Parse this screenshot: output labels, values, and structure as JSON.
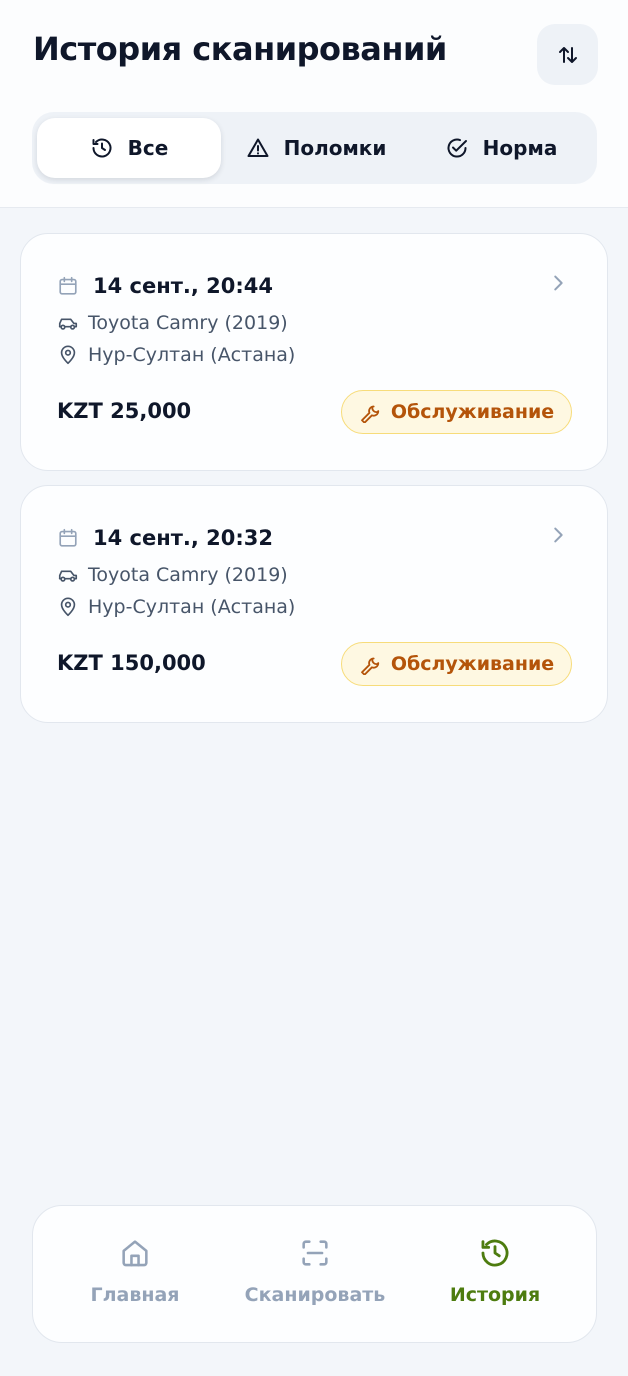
{
  "header": {
    "title": "История сканирований",
    "sort_icon": "sort-arrows-icon"
  },
  "filters": [
    {
      "label": "Все",
      "icon": "history-icon",
      "active": true
    },
    {
      "label": "Поломки",
      "icon": "warning-icon",
      "active": false
    },
    {
      "label": "Норма",
      "icon": "check-circle-icon",
      "active": false
    }
  ],
  "scans": [
    {
      "datetime": "14 сент., 20:44",
      "car": "Toyota Camry (2019)",
      "location": "Нур-Султан (Астана)",
      "price": "KZT 25,000",
      "status": "Обслуживание"
    },
    {
      "datetime": "14 сент., 20:32",
      "car": "Toyota Camry (2019)",
      "location": "Нур-Султан (Астана)",
      "price": "KZT 150,000",
      "status": "Обслуживание"
    }
  ],
  "nav": [
    {
      "label": "Главная",
      "icon": "home-icon",
      "active": false
    },
    {
      "label": "Сканировать",
      "icon": "scan-icon",
      "active": false
    },
    {
      "label": "История",
      "icon": "history-icon",
      "active": true
    }
  ],
  "colors": {
    "accent": "#4d7c0f",
    "badge_text": "#b4540a",
    "badge_bg": "#fef8e2",
    "badge_border": "#f7dc7a",
    "background": "#f3f6fa"
  }
}
